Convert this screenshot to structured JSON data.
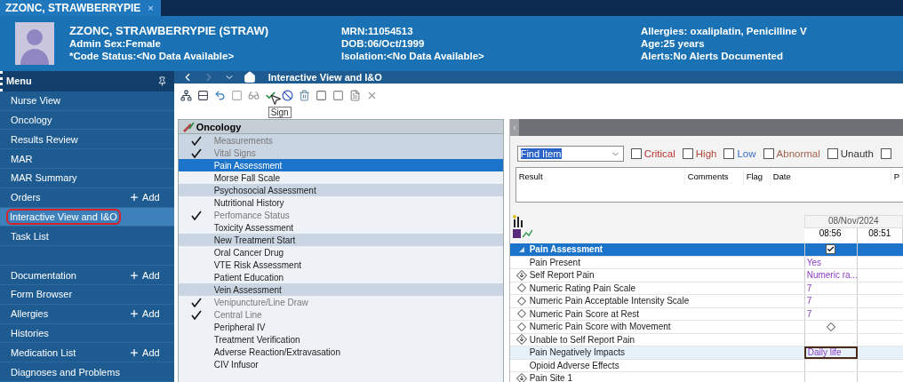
{
  "patient_tab": {
    "label": "ZZONC, STRAWBERRYPIE",
    "close": "×"
  },
  "banner": {
    "name": "ZZONC, STRAWBERRYPIE (STRAW)",
    "col1": [
      "Admin Sex:Female",
      "*Code Status:<No Data Available>"
    ],
    "col2": [
      "MRN:11054513",
      "DOB:06/Oct/1999",
      "Isolation:<No Data Available>"
    ],
    "col3": [
      "Allergies: oxaliplatin, Penicilline V",
      "Age:25 years",
      "Alerts:No Alerts Documented"
    ]
  },
  "menu": {
    "title": "Menu"
  },
  "nav": {
    "title": "Interactive View and I&O"
  },
  "sidebar": {
    "items": [
      {
        "kind": "link",
        "label": "Nurse View",
        "selected": false
      },
      {
        "kind": "link",
        "label": "Oncology",
        "selected": false
      },
      {
        "kind": "link",
        "label": "Results Review",
        "selected": false
      },
      {
        "kind": "link",
        "label": "MAR",
        "selected": false
      },
      {
        "kind": "link",
        "label": "MAR Summary",
        "selected": false
      },
      {
        "kind": "link",
        "label": "Orders",
        "add": "Add",
        "selected": false
      },
      {
        "kind": "link",
        "label": "Interactive View and I&O",
        "selected": true
      },
      {
        "kind": "link",
        "label": "Task List",
        "selected": false
      },
      {
        "kind": "spacer",
        "selected": false
      },
      {
        "kind": "link",
        "label": "Documentation",
        "add": "Add",
        "selected": false
      },
      {
        "kind": "link",
        "label": "Form Browser",
        "selected": false
      },
      {
        "kind": "link",
        "label": "Allergies",
        "add": "Add",
        "selected": false
      },
      {
        "kind": "link",
        "label": "Histories",
        "selected": false
      },
      {
        "kind": "link",
        "label": "Medication List",
        "add": "Add",
        "selected": false
      },
      {
        "kind": "link",
        "label": "Diagnoses and Problems",
        "selected": false
      }
    ]
  },
  "toolbar": {
    "tooltip": "Sign"
  },
  "band_list": {
    "title": "Oncology",
    "rows": [
      {
        "kind": "section",
        "label": "Measurements",
        "checked": true,
        "selected": false
      },
      {
        "kind": "section",
        "label": "Vital Signs",
        "checked": true,
        "selected": false
      },
      {
        "kind": "item",
        "label": "Pain Assessment",
        "checked": false,
        "selected": true
      },
      {
        "kind": "item",
        "label": "Morse Fall Scale",
        "checked": false,
        "selected": false
      },
      {
        "kind": "section",
        "label": "Psychosocial Assessment",
        "checked": false,
        "selected": false
      },
      {
        "kind": "item",
        "label": "Nutritional History",
        "checked": false,
        "selected": false
      },
      {
        "kind": "item",
        "label": "Perfomance Status",
        "checked": true,
        "selected": false
      },
      {
        "kind": "item",
        "label": "Toxicity Assessment",
        "checked": false,
        "selected": false
      },
      {
        "kind": "section",
        "label": "New Treatment Start",
        "checked": false,
        "selected": false
      },
      {
        "kind": "item",
        "label": "Oral Cancer Drug",
        "checked": false,
        "selected": false
      },
      {
        "kind": "item",
        "label": "VTE Risk Assessment",
        "checked": false,
        "selected": false
      },
      {
        "kind": "item",
        "label": "Patient Education",
        "checked": false,
        "selected": false
      },
      {
        "kind": "section",
        "label": "Vein Assessment",
        "checked": false,
        "selected": false
      },
      {
        "kind": "item",
        "label": "Venipuncture/Line Draw",
        "checked": true,
        "selected": false
      },
      {
        "kind": "item",
        "label": "Central Line",
        "checked": true,
        "selected": false
      },
      {
        "kind": "item",
        "label": "Peripheral IV",
        "checked": false,
        "selected": false
      },
      {
        "kind": "item",
        "label": "Treatment Verification",
        "checked": false,
        "selected": false
      },
      {
        "kind": "item",
        "label": "Adverse Reaction/Extravasation",
        "checked": false,
        "selected": false
      },
      {
        "kind": "item",
        "label": "CIV Infusor",
        "checked": false,
        "selected": false
      }
    ]
  },
  "filters": {
    "find": {
      "value": "Find Item"
    },
    "options": [
      {
        "label": "Critical",
        "checked": false,
        "color": "#b8322f"
      },
      {
        "label": "High",
        "checked": false,
        "color": "#b24a3a"
      },
      {
        "label": "Low",
        "checked": false,
        "color": "#3b6fc2"
      },
      {
        "label": "Abnormal",
        "checked": false,
        "color": "#a0644e"
      },
      {
        "label": "Unauth",
        "checked": false,
        "color": "#333333"
      },
      {
        "checked": false
      }
    ]
  },
  "results_table": {
    "columns": [
      "Result",
      "Comments",
      "Flag",
      "Date",
      "P"
    ]
  },
  "flowsheet": {
    "date": "08/Nov/2024",
    "times": [
      "08:56",
      "08:51"
    ],
    "rows": [
      {
        "kind": "section",
        "label": "Pain Assessment",
        "checked": true,
        "pending": false,
        "selected": true,
        "active": false
      },
      {
        "kind": "plain",
        "label": "Pain Present",
        "value": "Yes",
        "pending": false,
        "selected": false,
        "active": false
      },
      {
        "kind": "dual",
        "label": "Self Report Pain",
        "value": "Numeric ra...",
        "pending": false,
        "selected": false,
        "active": false
      },
      {
        "kind": "single",
        "label": "Numeric Rating Pain Scale",
        "value": "7",
        "pending": false,
        "selected": false,
        "active": false
      },
      {
        "kind": "single",
        "label": "Numeric Pain Acceptable Intensity Scale",
        "value": "7",
        "pending": false,
        "selected": false,
        "active": false
      },
      {
        "kind": "single",
        "label": "Numeric Pain Score at Rest",
        "value": "7",
        "pending": false,
        "selected": false,
        "active": false
      },
      {
        "kind": "single",
        "label": "Numeric Pain Score with Movement",
        "pending": true,
        "selected": false,
        "active": false
      },
      {
        "kind": "dual",
        "label": "Unable to Self Report Pain",
        "pending": false,
        "selected": false,
        "active": false
      },
      {
        "kind": "plain",
        "label": "Pain Negatively Impacts",
        "value": "Daily life",
        "pending": false,
        "selected": false,
        "active": true
      },
      {
        "kind": "plain",
        "label": "Opioid Adverse Effects",
        "pending": false,
        "selected": false,
        "active": false
      },
      {
        "kind": "dual",
        "label": "Pain Site 1",
        "pending": false,
        "selected": false,
        "active": false
      }
    ]
  }
}
